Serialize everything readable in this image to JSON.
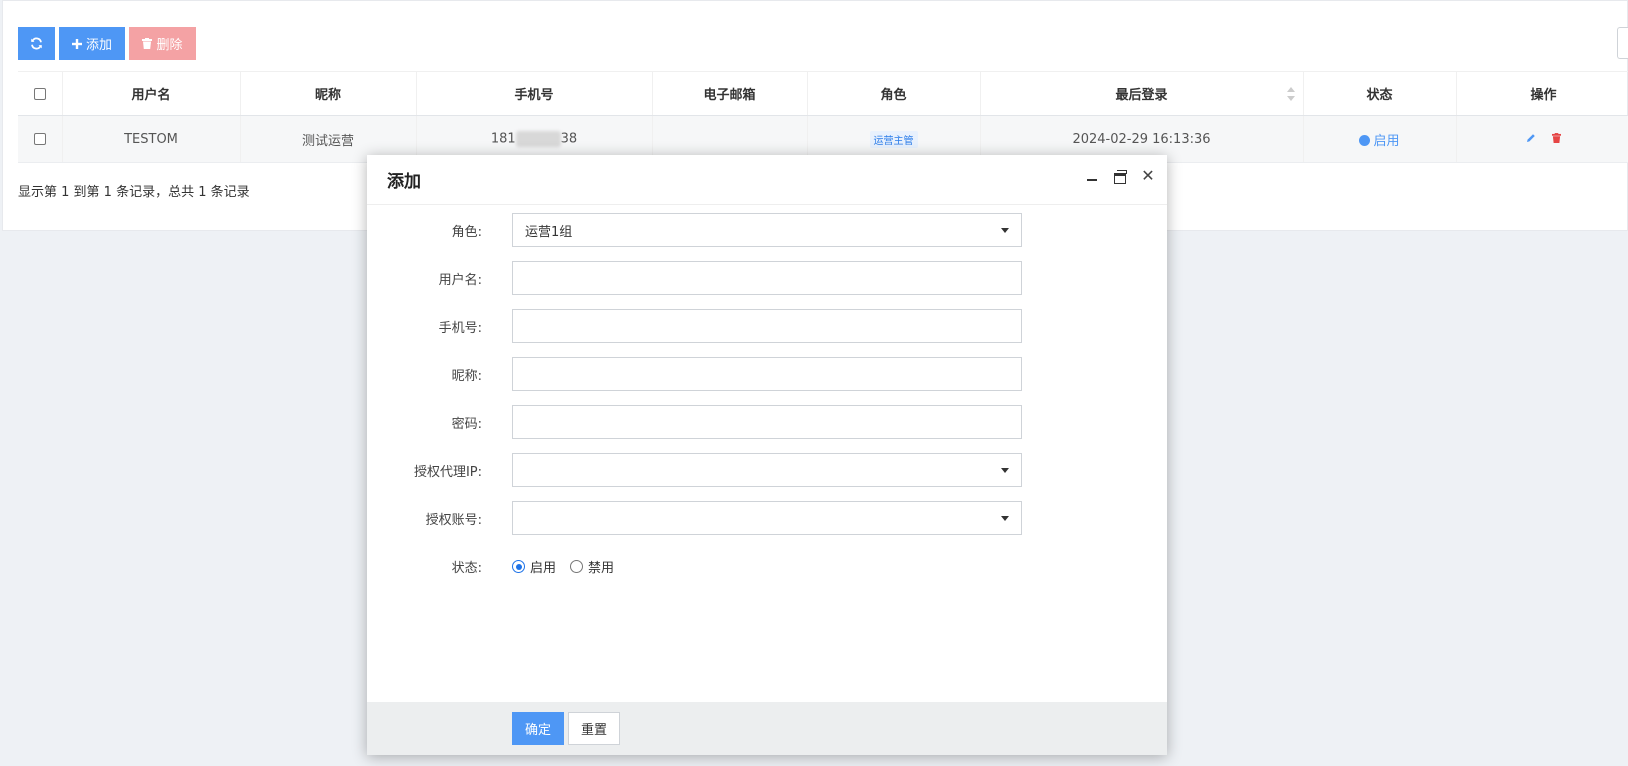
{
  "toolbar": {
    "refresh_icon": "refresh-icon",
    "add_label": "添加",
    "delete_label": "删除"
  },
  "table": {
    "columns": [
      "用户名",
      "昵称",
      "手机号",
      "电子邮箱",
      "角色",
      "最后登录",
      "状态",
      "操作"
    ],
    "rows": [
      {
        "username": "TESTOM",
        "nickname": "测试运营",
        "phone_prefix": "181",
        "phone_suffix": "38",
        "email": "",
        "role": "运营主管",
        "last_login": "2024-02-29 16:13:36",
        "status": "启用"
      }
    ]
  },
  "pager": {
    "text": "显示第 1 到第 1 条记录，总共 1 条记录"
  },
  "modal": {
    "title": "添加",
    "fields": {
      "role_label": "角色:",
      "role_value": "运营1组",
      "username_label": "用户名:",
      "phone_label": "手机号:",
      "nickname_label": "昵称:",
      "password_label": "密码:",
      "proxy_ip_label": "授权代理IP:",
      "account_label": "授权账号:",
      "status_label": "状态:",
      "status_enabled": "启用",
      "status_disabled": "禁用"
    },
    "confirm_label": "确定",
    "reset_label": "重置"
  },
  "colors": {
    "primary": "#4e97f5",
    "danger_light": "#f4a2a4",
    "danger": "#e64545"
  }
}
